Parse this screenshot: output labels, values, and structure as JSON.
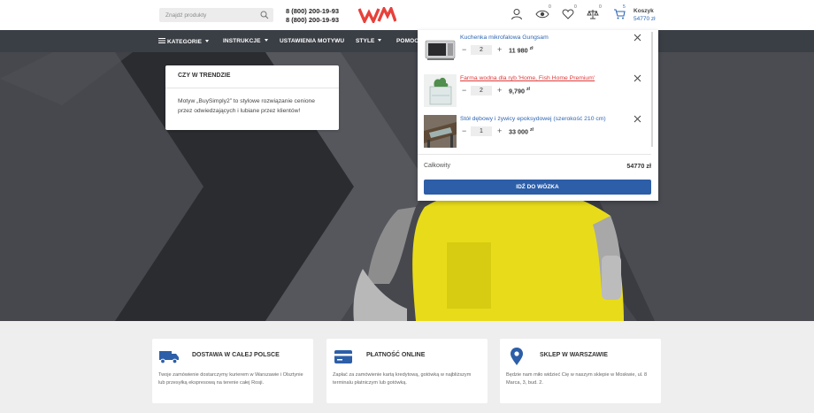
{
  "header": {
    "search_placeholder": "Znajdź produkty",
    "phone_1": "8 (800) 200-19-93",
    "phone_2": "8 (800) 200-19-93",
    "logo_text": "WM",
    "compare_count": "0",
    "wishlist_count": "0",
    "scales_count": "0",
    "cart_count": "5",
    "cart_label": "Koszyk",
    "cart_amount": "54770 zł"
  },
  "nav": {
    "items": [
      {
        "label": "KATEGORIE"
      },
      {
        "label": "INSTRUKCJE"
      },
      {
        "label": "USTAWIENIA MOTYWU"
      },
      {
        "label": "STYLE"
      },
      {
        "label": "POMOC"
      }
    ]
  },
  "hero": {
    "trend_title": "CZY W TRENDZIE",
    "trend_body": "Motyw „BuySimply2” to stylowe rozwiązanie cenione przez odwiedzających i lubiane przez klientów!"
  },
  "cart_popup": {
    "items": [
      {
        "name": "Kuchenka mikrofalowa Gungsam",
        "qty": "2",
        "price": "11 980",
        "currency": "zł"
      },
      {
        "name": "Farma wodna dla ryb 'Home, Fish Home Premium'",
        "qty": "2",
        "price": "9,790",
        "currency": "zł"
      },
      {
        "name": "Stół dębowy i żywicy epoksydowej (szerokość 210 cm)",
        "qty": "1",
        "price": "33 000",
        "currency": "zł"
      }
    ],
    "total_label": "Całkowity",
    "total_value": "54770 zł",
    "go_label": "IDŹ DO WÓZKA"
  },
  "features": [
    {
      "title": "DOSTAWA W CAŁEJ POLSCE",
      "body": "Twoje zamówienie dostarczymy kurierem w Warszawie i Olsztynie lub przesyłką ekspresową na terenie całej Rosji.",
      "icon": "truck-icon"
    },
    {
      "title": "PŁATNOŚĆ ONLINE",
      "body": "Zapłać za zamówienie kartą kredytową, gotówką w najbliższym terminalu płatniczym lub gotówką.",
      "icon": "credit-card-icon"
    },
    {
      "title": "SKLEP W WARSZAWIE",
      "body": "Będzie nam miło widzieć Cię w naszym sklepie w Moskwie, ul. 8 Marca, 3, bud. 2.",
      "icon": "map-pin-icon"
    }
  ],
  "colors": {
    "accent": "#2e66b3",
    "logo": "#e8403b",
    "nav": "#3a3e45",
    "shirt": "#e8dc1a"
  }
}
